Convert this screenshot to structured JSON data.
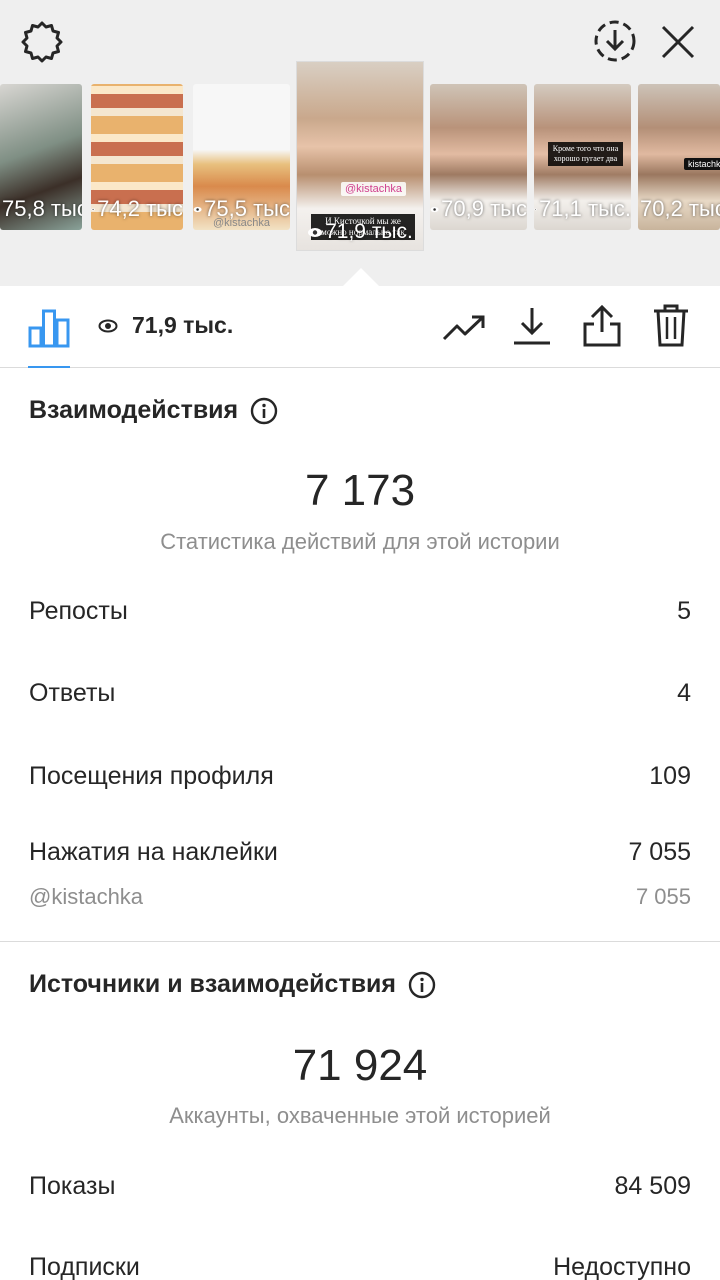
{
  "header": {
    "settings_icon": "gear-icon",
    "download_icon": "download-circle-icon",
    "close_icon": "close-icon"
  },
  "thumbnails": [
    {
      "views": "75,8 тыс",
      "tag": "",
      "caption": ""
    },
    {
      "views": "74,2 тыс",
      "tag": "",
      "caption": ""
    },
    {
      "views": "75,5 тыс",
      "tag": "@kistachka",
      "caption": ""
    },
    {
      "views": "71,9 тыс.",
      "tag": "@kistachka",
      "caption": "И Кисточкой мы же можно нормально так"
    },
    {
      "views": "70,9 тыс",
      "tag": "",
      "caption": ""
    },
    {
      "views": "71,1 тыс.",
      "tag": "",
      "caption": "Кроме того что она хорошо пугает два"
    },
    {
      "views": "70,2 тыс",
      "tag": "kistachka",
      "caption": ""
    }
  ],
  "toolbar": {
    "views": "71,9 тыс.",
    "insights_icon": "bar-chart-icon",
    "trending_icon": "trending-icon",
    "save_icon": "download-icon",
    "share_icon": "share-icon",
    "delete_icon": "trash-icon"
  },
  "interactions": {
    "title": "Взаимодействия",
    "total": "7 173",
    "subtitle": "Статистика действий для этой истории",
    "rows": [
      {
        "label": "Репосты",
        "value": "5"
      },
      {
        "label": "Ответы",
        "value": "4"
      },
      {
        "label": "Посещения профиля",
        "value": "109"
      },
      {
        "label": "Нажатия на наклейки",
        "value": "7 055"
      }
    ],
    "sticker": {
      "label": "@kistachka",
      "value": "7 055"
    }
  },
  "discovery": {
    "title": "Источники и взаимодействия",
    "total": "71 924",
    "subtitle": "Аккаунты, охваченные этой историей",
    "rows": [
      {
        "label": "Показы",
        "value": "84 509"
      },
      {
        "label": "Подписки",
        "value": "Недоступно"
      }
    ]
  }
}
